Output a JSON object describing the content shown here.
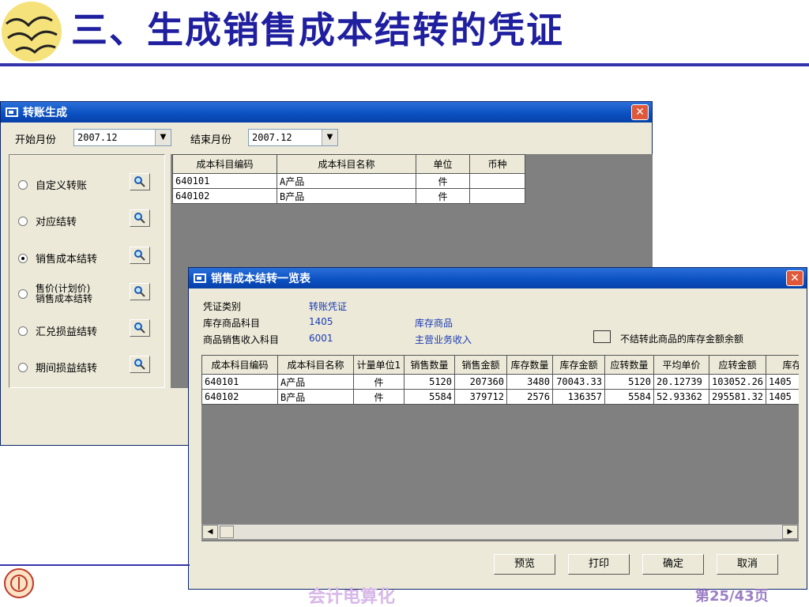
{
  "slide": {
    "title": "三、生成销售成本结转的凭证",
    "footer_left": "会计电算化",
    "footer_right": "第25/43页"
  },
  "transfer_window": {
    "title": "转账生成",
    "start_month_label": "开始月份",
    "start_month_value": "2007.12",
    "end_month_label": "结束月份",
    "end_month_value": "2007.12",
    "options": [
      {
        "label": "自定义转账",
        "selected": false
      },
      {
        "label": "对应结转",
        "selected": false
      },
      {
        "label": "销售成本结转",
        "selected": true
      },
      {
        "label_line1": "售价(计划价)",
        "label_line2": "销售成本结转",
        "selected": false
      },
      {
        "label": "汇兑损益结转",
        "selected": false
      },
      {
        "label": "期间损益结转",
        "selected": false
      }
    ],
    "grid": {
      "headers": [
        "成本科目编码",
        "成本科目名称",
        "单位",
        "币种"
      ],
      "rows": [
        [
          "640101",
          "A产品",
          "件",
          ""
        ],
        [
          "640102",
          "B产品",
          "件",
          ""
        ]
      ]
    }
  },
  "summary_dialog": {
    "title": "销售成本结转一览表",
    "voucher_type_label": "凭证类别",
    "voucher_type_value": "转账凭证",
    "stock_subject_label": "库存商品科目",
    "stock_subject_code": "1405",
    "stock_subject_name": "库存商品",
    "income_subject_label": "商品销售收入科目",
    "income_subject_code": "6001",
    "income_subject_name": "主营业务收入",
    "no_transfer_label": "不结转此商品的库存金额余额",
    "no_transfer_checked": false,
    "grid": {
      "headers": [
        "成本科目编码",
        "成本科目名称",
        "计量单位1",
        "销售数量",
        "销售金额",
        "库存数量",
        "库存金额",
        "应转数量",
        "平均单价",
        "应转金额",
        "库存"
      ],
      "rows": [
        [
          "640101",
          "A产品",
          "件",
          "5120",
          "207360",
          "3480",
          "70043.33",
          "5120",
          "20.12739",
          "103052.26",
          "1405"
        ],
        [
          "640102",
          "B产品",
          "件",
          "5584",
          "379712",
          "2576",
          "136357",
          "5584",
          "52.93362",
          "295581.32",
          "1405"
        ]
      ]
    },
    "buttons": {
      "preview": "预览",
      "print": "打印",
      "ok": "确定",
      "cancel": "取消"
    }
  }
}
